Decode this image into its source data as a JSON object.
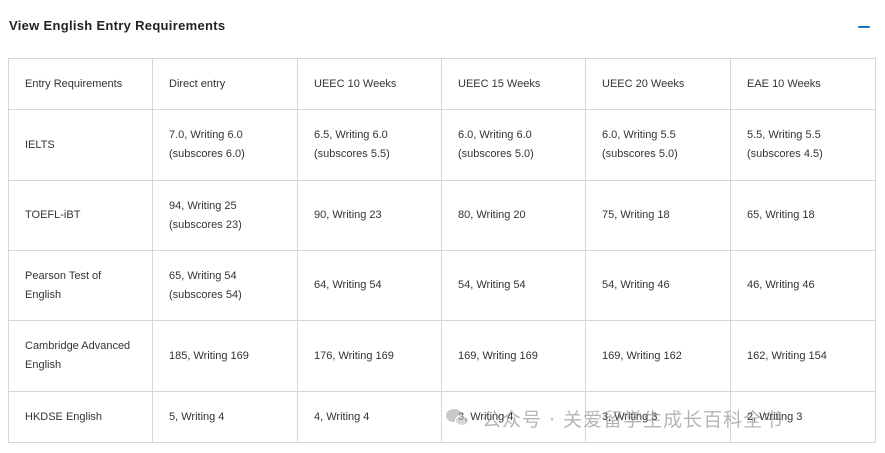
{
  "section": {
    "title": "View English Entry Requirements",
    "toggle_icon": "minus-icon",
    "accent_color": "#1f6fd1"
  },
  "table": {
    "headers": [
      "Entry Requirements",
      "Direct entry",
      "UEEC 10 Weeks",
      "UEEC 15 Weeks",
      "UEEC 20 Weeks",
      "EAE 10 Weeks"
    ],
    "rows": [
      {
        "label": [
          "IELTS"
        ],
        "cells": [
          [
            "7.0, Writing 6.0",
            "(subscores 6.0)"
          ],
          [
            "6.5, Writing 6.0",
            "(subscores 5.5)"
          ],
          [
            "6.0, Writing 6.0",
            "(subscores 5.0)"
          ],
          [
            "6.0, Writing 5.5",
            "(subscores 5.0)"
          ],
          [
            "5.5, Writing 5.5",
            "(subscores 4.5)"
          ]
        ]
      },
      {
        "label": [
          "TOEFL-iBT"
        ],
        "cells": [
          [
            "94, Writing 25",
            "(subscores 23)"
          ],
          [
            "90, Writing 23"
          ],
          [
            "80, Writing 20"
          ],
          [
            "75, Writing 18"
          ],
          [
            "65, Writing 18"
          ]
        ]
      },
      {
        "label": [
          "Pearson Test of",
          "English"
        ],
        "cells": [
          [
            "65, Writing 54",
            "(subscores 54)"
          ],
          [
            "64, Writing 54"
          ],
          [
            "54, Writing 54"
          ],
          [
            "54, Writing 46"
          ],
          [
            "46, Writing 46"
          ]
        ]
      },
      {
        "label": [
          "Cambridge Advanced",
          "English"
        ],
        "cells": [
          [
            "185, Writing 169"
          ],
          [
            "176, Writing 169"
          ],
          [
            "169, Writing 169"
          ],
          [
            "169, Writing 162"
          ],
          [
            "162, Writing 154"
          ]
        ]
      },
      {
        "label": [
          "HKDSE English"
        ],
        "cells": [
          [
            "5, Writing 4"
          ],
          [
            "4, Writing 4"
          ],
          [
            "3, Writing 4"
          ],
          [
            "3, Writing 3"
          ],
          [
            "2, Writing 3"
          ]
        ]
      }
    ]
  },
  "watermark": {
    "text": "公众号 · 关爱留学生成长百科全书",
    "icon": "wechat-icon"
  }
}
